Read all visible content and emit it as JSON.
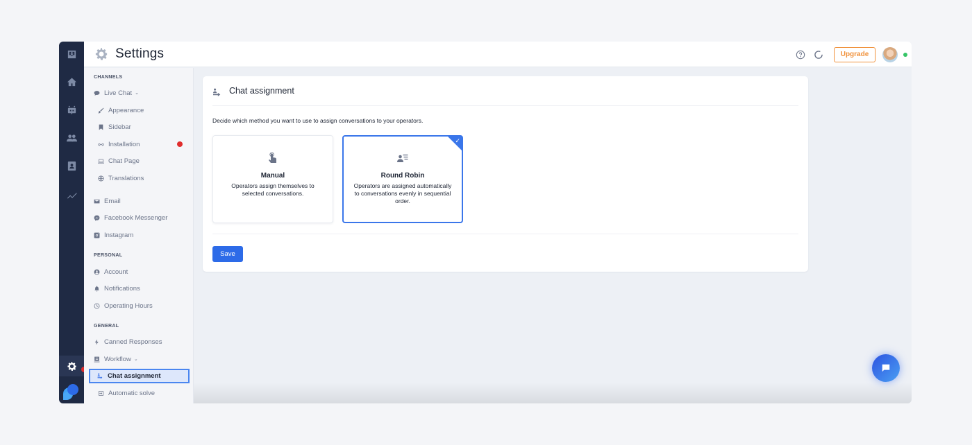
{
  "header": {
    "title": "Settings",
    "upgrade_label": "Upgrade",
    "icons": [
      "help-circle-icon",
      "loading-circle-icon"
    ],
    "user_status": "online"
  },
  "rail": {
    "icons": [
      "inbox-icon",
      "home-icon",
      "bot-icon",
      "users-icon",
      "contacts-icon",
      "analytics-icon",
      "settings-icon",
      "app-logo"
    ]
  },
  "sidebar": {
    "sections": {
      "channels": "CHANNELS",
      "personal": "PERSONAL",
      "general": "GENERAL"
    },
    "items": {
      "live_chat": "Live Chat",
      "appearance": "Appearance",
      "sidebar": "Sidebar",
      "installation": "Installation",
      "chat_page": "Chat Page",
      "translations": "Translations",
      "email": "Email",
      "facebook_messenger": "Facebook Messenger",
      "instagram": "Instagram",
      "account": "Account",
      "notifications": "Notifications",
      "operating_hours": "Operating Hours",
      "canned_responses": "Canned Responses",
      "workflow": "Workflow",
      "chat_assignment": "Chat assignment",
      "automatic_solve": "Automatic solve"
    },
    "active_item": "Chat assignment"
  },
  "main": {
    "title": "Chat assignment",
    "description": "Decide which method you want to use to assign conversations to your operators.",
    "options": [
      {
        "name": "Manual",
        "description": "Operators assign themselves to selected conversations.",
        "selected": false
      },
      {
        "name": "Round Robin",
        "description": "Operators are assigned automatically to conversations evenly in sequential order.",
        "selected": true
      }
    ],
    "save_label": "Save"
  },
  "colors": {
    "accent": "#2d6be8",
    "upgrade": "#f0913a",
    "notification_dot": "#e02d2d",
    "rail_bg": "#1f2a44",
    "online": "#35c466"
  }
}
